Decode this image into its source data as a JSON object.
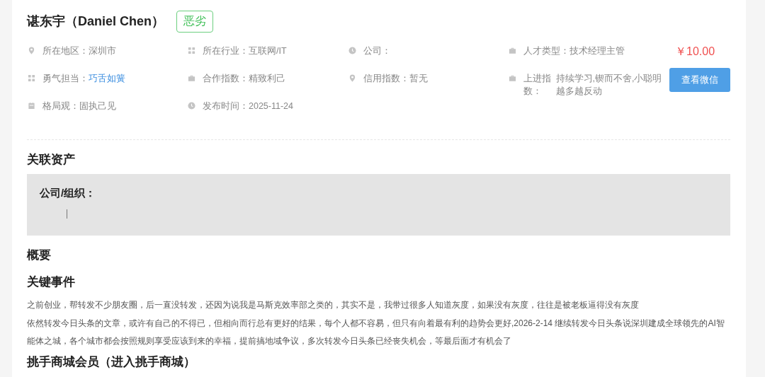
{
  "header": {
    "name": "谌东宇（Daniel Chen）",
    "tag": "恶劣"
  },
  "info_rows": [
    [
      {
        "kind": "pin",
        "label": "所在地区：",
        "value": "深圳市"
      },
      {
        "kind": "grid",
        "label": "所在行业：",
        "value": "互联网/IT"
      },
      {
        "kind": "clock",
        "label": "公司："
      },
      {
        "kind": "briefcase",
        "label": "人才类型：",
        "value": "技术经理主管"
      }
    ],
    [
      {
        "kind": "grid",
        "label": "勇气担当：",
        "link": "巧舌如簧"
      },
      {
        "kind": "briefcase",
        "label": "合作指数：",
        "value": "精致利己"
      },
      {
        "kind": "pin",
        "label": "信用指数：",
        "value": "暂无"
      },
      {
        "kind": "briefcase",
        "label": "上进指数：",
        "value": "持续学习,锲而不舍,小聪明越多越反动"
      }
    ],
    [
      {
        "kind": "calendar",
        "label": "格局观：",
        "value": "固执己见"
      },
      {
        "kind": "clock",
        "label": "发布时间：",
        "value": "2025-11-24"
      }
    ]
  ],
  "price": "￥10.00",
  "action_button": "查看微信",
  "assets": {
    "heading": "关联资产",
    "label": "公司/组织："
  },
  "overview": {
    "heading": "概要"
  },
  "events": {
    "heading": "关键事件",
    "paragraphs": [
      "之前创业，帮转发不少朋友圈，后一直没转发，还因为说我是马斯克效率部之类的，其实不是，我带过很多人知道灰度，如果没有灰度，往往是被老板逼得没有灰度",
      "依然转发今日头条的文章，或许有自己的不得已，但相向而行总有更好的结果，每个人都不容易，但只有向着最有利的趋势会更好,2026-2-14 继续转发今日头条说深圳建成全球领先的AI智能体之城，各个城市都会按照规则享受应该到来的幸福，提前搞地域争议，多次转发今日头条已经丧失机会，等最后面才有机会了"
    ]
  },
  "membership": {
    "heading": "挑手商城会员（进入挑手商城）"
  }
}
